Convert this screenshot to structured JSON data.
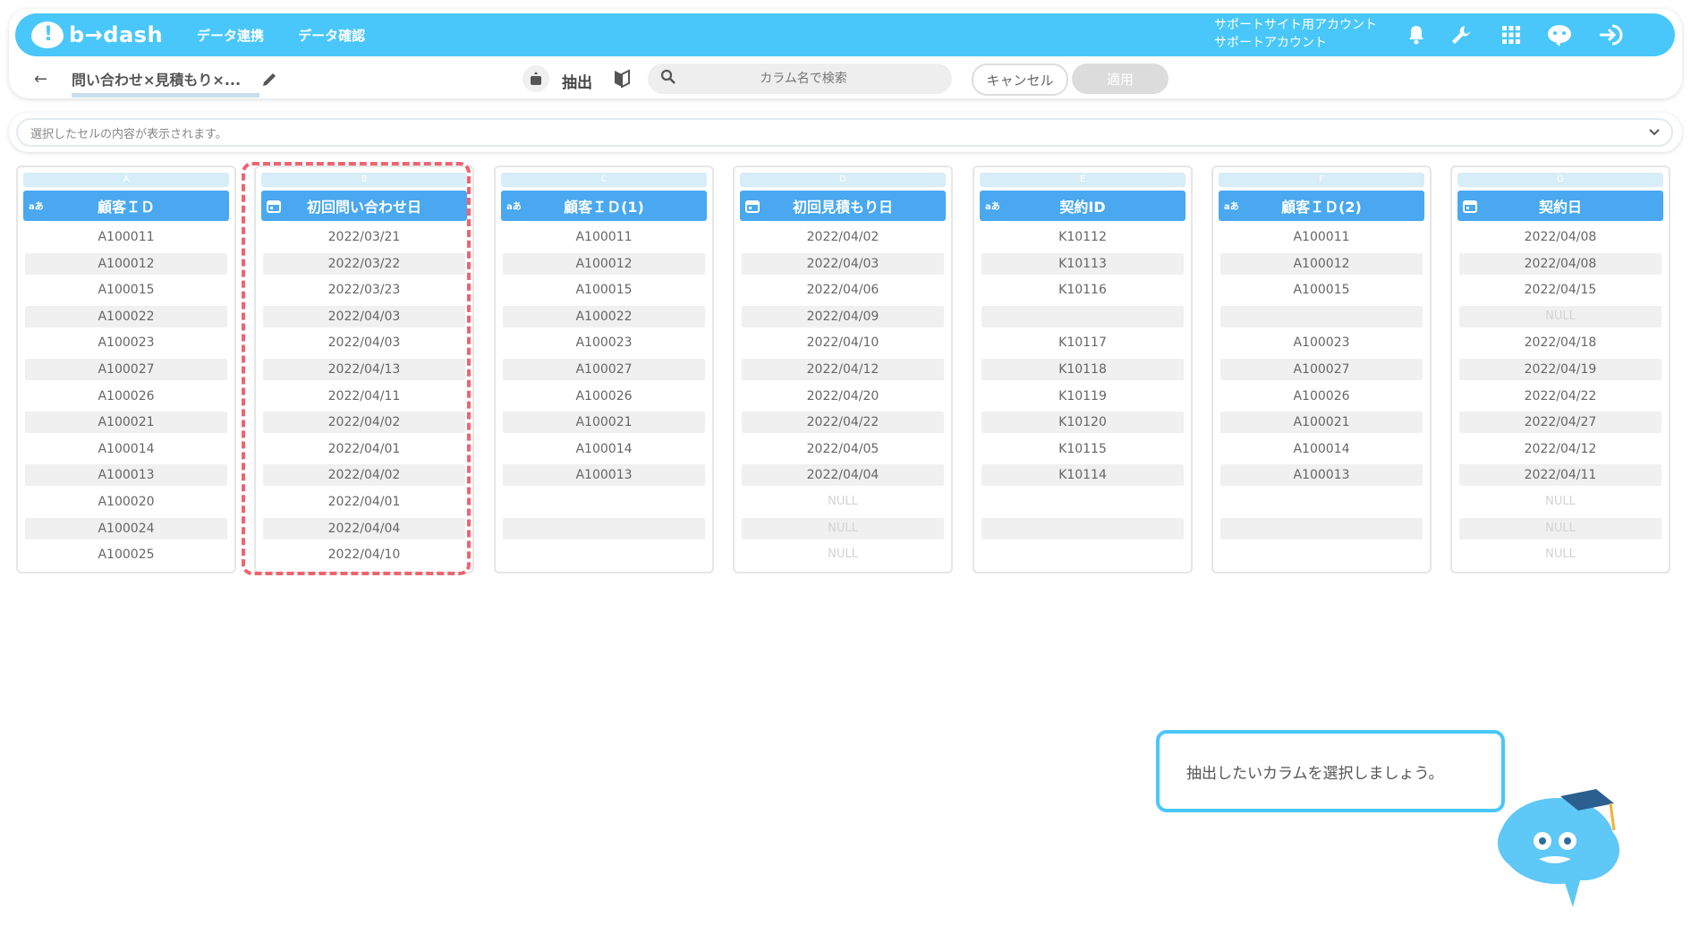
{
  "header": {
    "logo": "b→dash",
    "nav": [
      "データ連携",
      "データ確認"
    ],
    "account_line1": "サポートサイト用アカウント",
    "account_line2": "サポートアカウント",
    "icons": [
      "bell-icon",
      "wrench-icon",
      "apps-grid-icon",
      "chat-bot-icon",
      "logout-icon"
    ]
  },
  "toolbar": {
    "back_label": "←",
    "title": "問い合わせ×見積もり×...",
    "extract_label": "抽出",
    "search_placeholder": "カラム名で検索",
    "cancel_label": "キャンセル",
    "apply_label": "適用"
  },
  "cellbar": {
    "placeholder": "選択したセルの内容が表示されます。"
  },
  "columns": [
    {
      "letter": "A",
      "type": "text",
      "type_label": "aあ",
      "name": "顧客ＩＤ",
      "rows": [
        "A100011",
        "A100012",
        "A100015",
        "A100022",
        "A100023",
        "A100027",
        "A100026",
        "A100021",
        "A100014",
        "A100013",
        "A100020",
        "A100024",
        "A100025"
      ]
    },
    {
      "letter": "B",
      "type": "date",
      "type_label": "",
      "name": "初回問い合わせ日",
      "rows": [
        "2022/03/21",
        "2022/03/22",
        "2022/03/23",
        "2022/04/03",
        "2022/04/03",
        "2022/04/13",
        "2022/04/11",
        "2022/04/02",
        "2022/04/01",
        "2022/04/02",
        "2022/04/01",
        "2022/04/04",
        "2022/04/10"
      ]
    },
    {
      "letter": "C",
      "type": "text",
      "type_label": "aあ",
      "name": "顧客ＩＤ(1)",
      "rows": [
        "A100011",
        "A100012",
        "A100015",
        "A100022",
        "A100023",
        "A100027",
        "A100026",
        "A100021",
        "A100014",
        "A100013",
        "",
        "",
        ""
      ]
    },
    {
      "letter": "D",
      "type": "date",
      "type_label": "",
      "name": "初回見積もり日",
      "rows": [
        "2022/04/02",
        "2022/04/03",
        "2022/04/06",
        "2022/04/09",
        "2022/04/10",
        "2022/04/12",
        "2022/04/20",
        "2022/04/22",
        "2022/04/05",
        "2022/04/04",
        "NULL",
        "NULL",
        "NULL"
      ]
    },
    {
      "letter": "E",
      "type": "text",
      "type_label": "aあ",
      "name": "契約ID",
      "rows": [
        "K10112",
        "K10113",
        "K10116",
        "",
        "K10117",
        "K10118",
        "K10119",
        "K10120",
        "K10115",
        "K10114",
        "",
        "",
        ""
      ]
    },
    {
      "letter": "F",
      "type": "text",
      "type_label": "aあ",
      "name": "顧客ＩＤ(2)",
      "rows": [
        "A100011",
        "A100012",
        "A100015",
        "",
        "A100023",
        "A100027",
        "A100026",
        "A100021",
        "A100014",
        "A100013",
        "",
        "",
        ""
      ]
    },
    {
      "letter": "G",
      "type": "date",
      "type_label": "",
      "name": "契約日",
      "rows": [
        "2022/04/08",
        "2022/04/08",
        "2022/04/15",
        "NULL",
        "2022/04/18",
        "2022/04/19",
        "2022/04/22",
        "2022/04/27",
        "2022/04/12",
        "2022/04/11",
        "NULL",
        "NULL",
        "NULL"
      ]
    }
  ],
  "bubble": {
    "text": "抽出したいカラムを選択しましょう。"
  },
  "colors": {
    "header_bg": "#49c7fa",
    "column_header_bg": "#49a8f0",
    "highlight": "#ee6470"
  }
}
